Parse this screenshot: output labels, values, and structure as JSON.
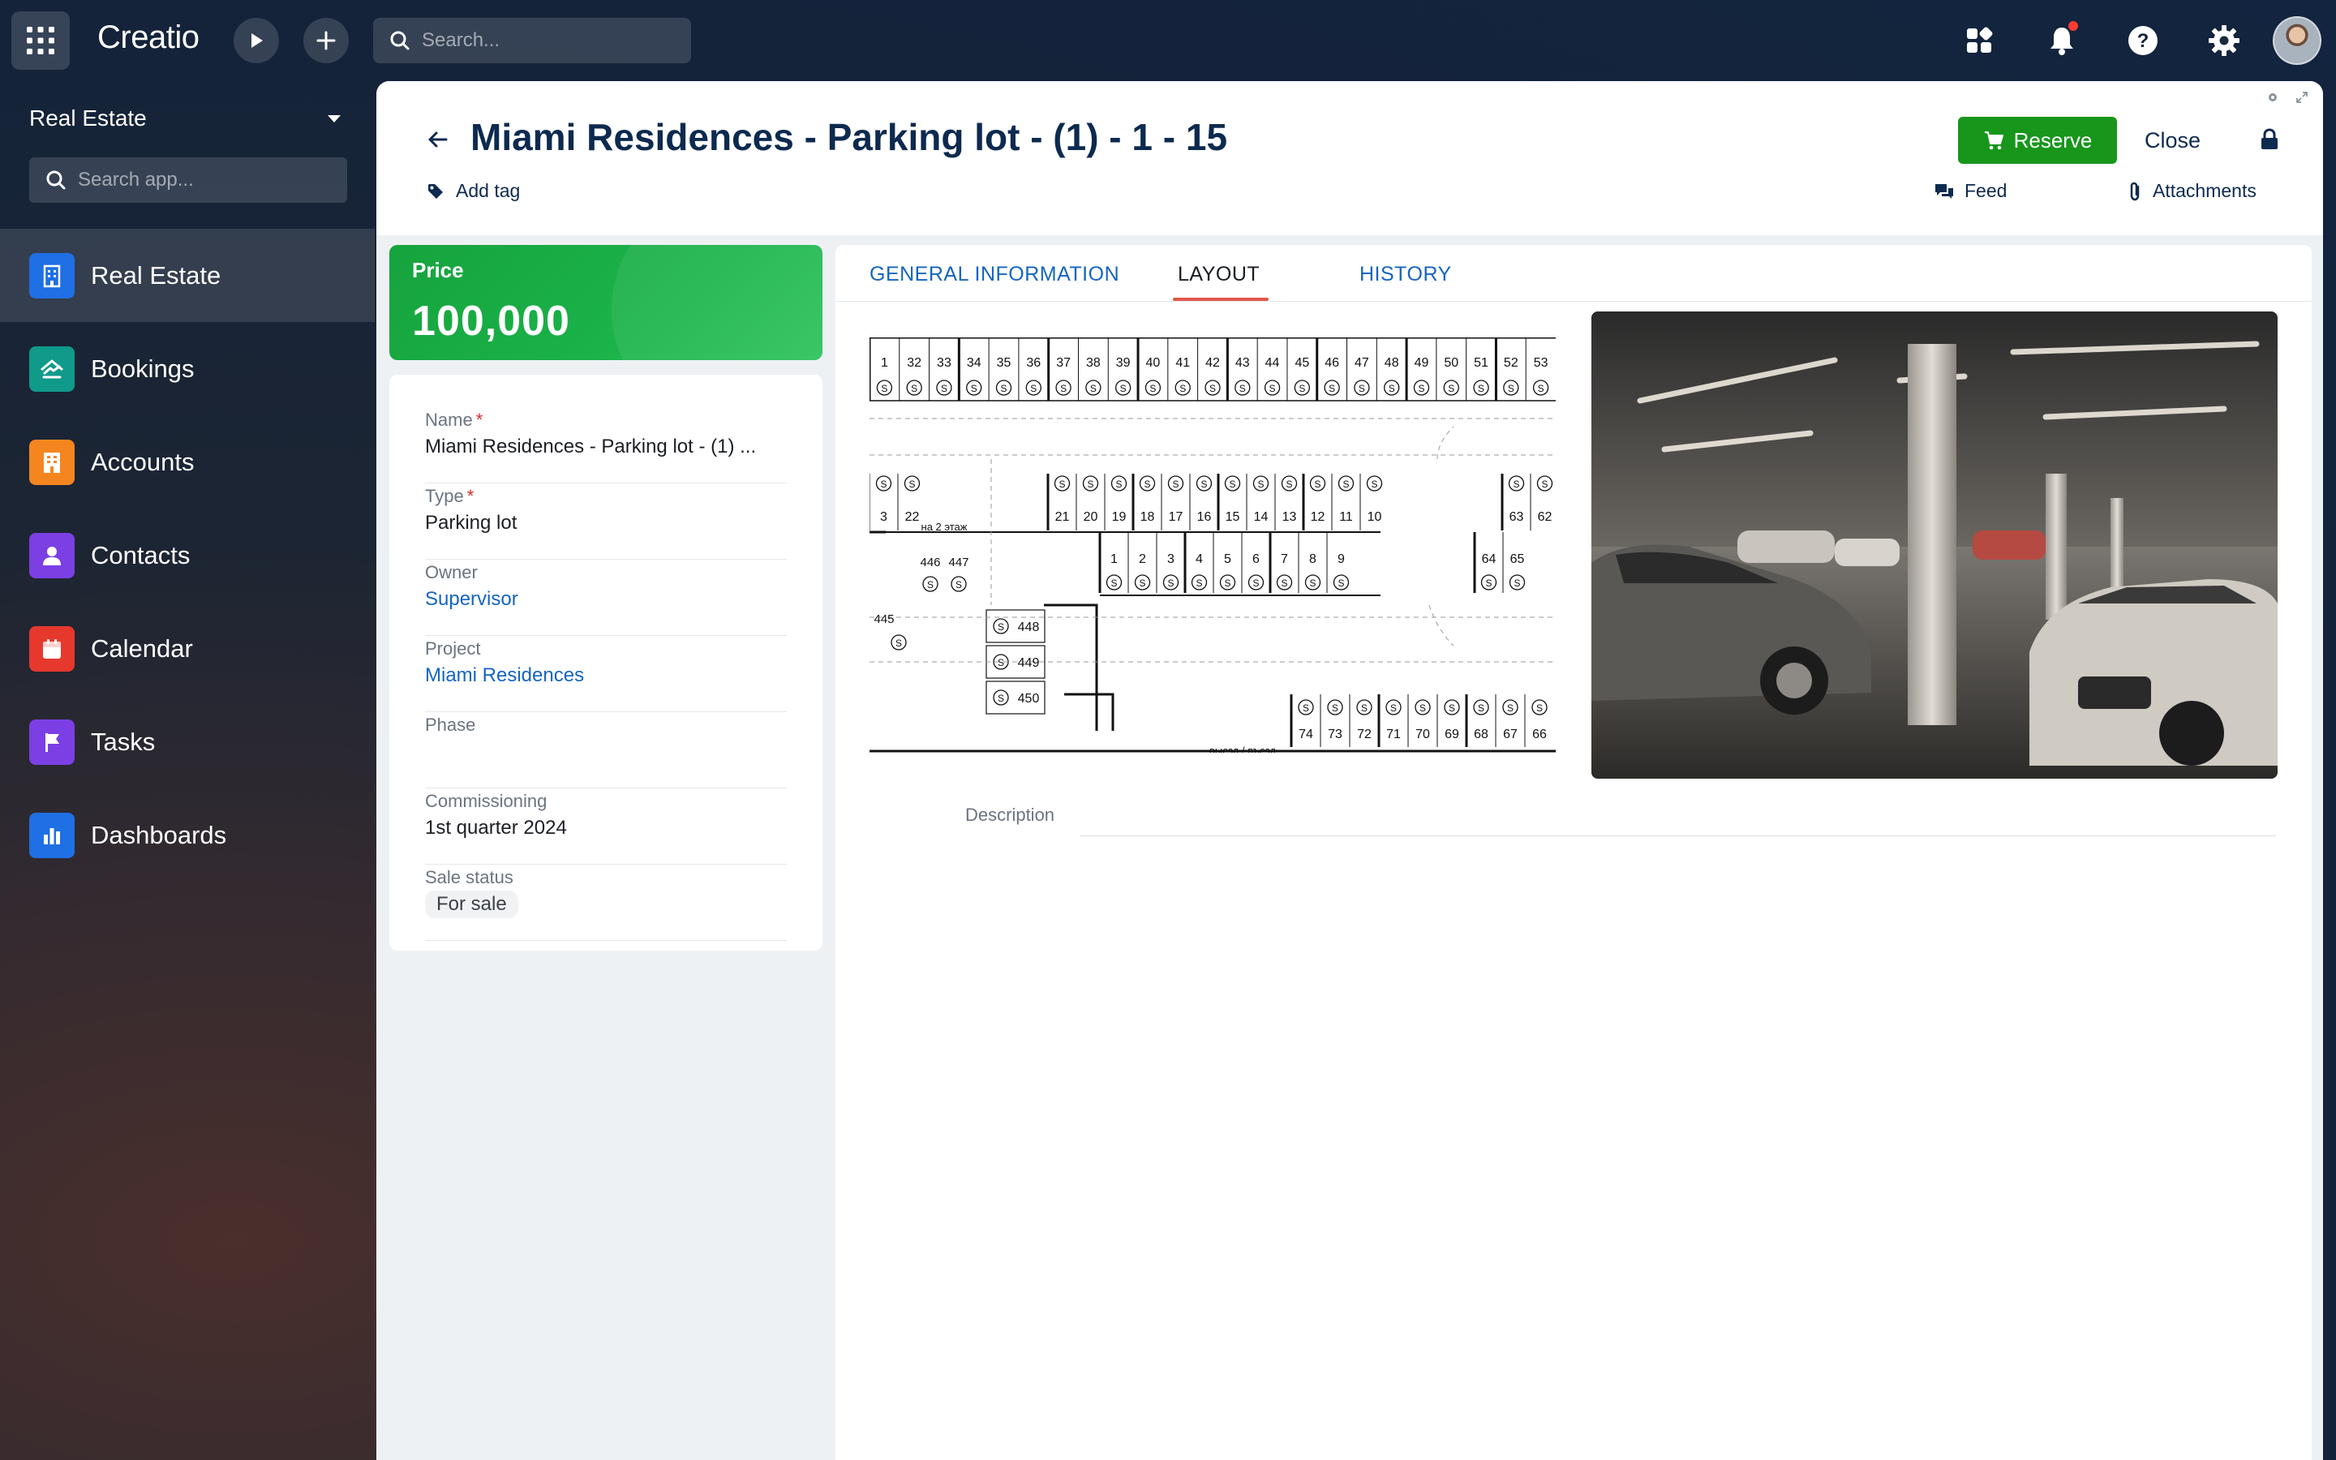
{
  "topbar": {
    "logo": "Creatio",
    "search_placeholder": "Search..."
  },
  "sidebar": {
    "workspace": "Real Estate",
    "search_placeholder": "Search app...",
    "items": [
      {
        "label": "Real Estate",
        "icon": "building-icon",
        "color": "#1f6fe5"
      },
      {
        "label": "Bookings",
        "icon": "handshake-icon",
        "color": "#0f9a8a"
      },
      {
        "label": "Accounts",
        "icon": "office-icon",
        "color": "#f5861f"
      },
      {
        "label": "Contacts",
        "icon": "person-icon",
        "color": "#7b3fe4"
      },
      {
        "label": "Calendar",
        "icon": "calendar-icon",
        "color": "#e7382e"
      },
      {
        "label": "Tasks",
        "icon": "flag-icon",
        "color": "#7b3fe4"
      },
      {
        "label": "Dashboards",
        "icon": "bar-chart-icon",
        "color": "#1f6fe5"
      }
    ]
  },
  "header": {
    "title": "Miami Residences - Parking lot - (1) - 1 - 15",
    "add_tag": "Add tag",
    "reserve": "Reserve",
    "close": "Close",
    "feed": "Feed",
    "attachments": "Attachments"
  },
  "price": {
    "label": "Price",
    "value": "100,000"
  },
  "fields": {
    "name_label": "Name",
    "name_value": "Miami Residences - Parking lot - (1) ...",
    "type_label": "Type",
    "type_value": "Parking lot",
    "owner_label": "Owner",
    "owner_value": "Supervisor",
    "project_label": "Project",
    "project_value": "Miami Residences",
    "phase_label": "Phase",
    "phase_value": "",
    "commissioning_label": "Commissioning",
    "commissioning_value": "1st quarter 2024",
    "sale_status_label": "Sale status",
    "sale_status_value": "For sale"
  },
  "tabs": [
    "GENERAL INFORMATION",
    "LAYOUT",
    "HISTORY"
  ],
  "active_tab": "LAYOUT",
  "layout": {
    "description_label": "Description",
    "plan_labels": {
      "top_row": [
        "1",
        "32",
        "33",
        "34",
        "35",
        "36",
        "37",
        "38",
        "39",
        "40",
        "41",
        "42",
        "43",
        "44",
        "45",
        "46",
        "47",
        "48",
        "49",
        "50",
        "51",
        "52",
        "53"
      ],
      "mid_row_top": [
        "3",
        "22",
        "21",
        "20",
        "19",
        "18",
        "17",
        "16",
        "15",
        "14",
        "13",
        "12",
        "11",
        "10",
        "63",
        "62"
      ],
      "mid_row_bottom": [
        "1",
        "2",
        "3",
        "4",
        "5",
        "6",
        "7",
        "8",
        "9",
        "64",
        "65"
      ],
      "cluster": [
        "446",
        "447",
        "445",
        "448",
        "449",
        "450"
      ],
      "bottom_row": [
        "74",
        "73",
        "72",
        "71",
        "70",
        "69",
        "68",
        "67",
        "66"
      ],
      "upstairs_note": "на 2 этаж",
      "exit_note": "выезд / въезд",
      "spot_symbol": "S"
    }
  },
  "colors": {
    "brand_green": "#17961b",
    "title": "#0d2a4f",
    "link": "#1565c0",
    "tab_underline": "#e0574b"
  }
}
